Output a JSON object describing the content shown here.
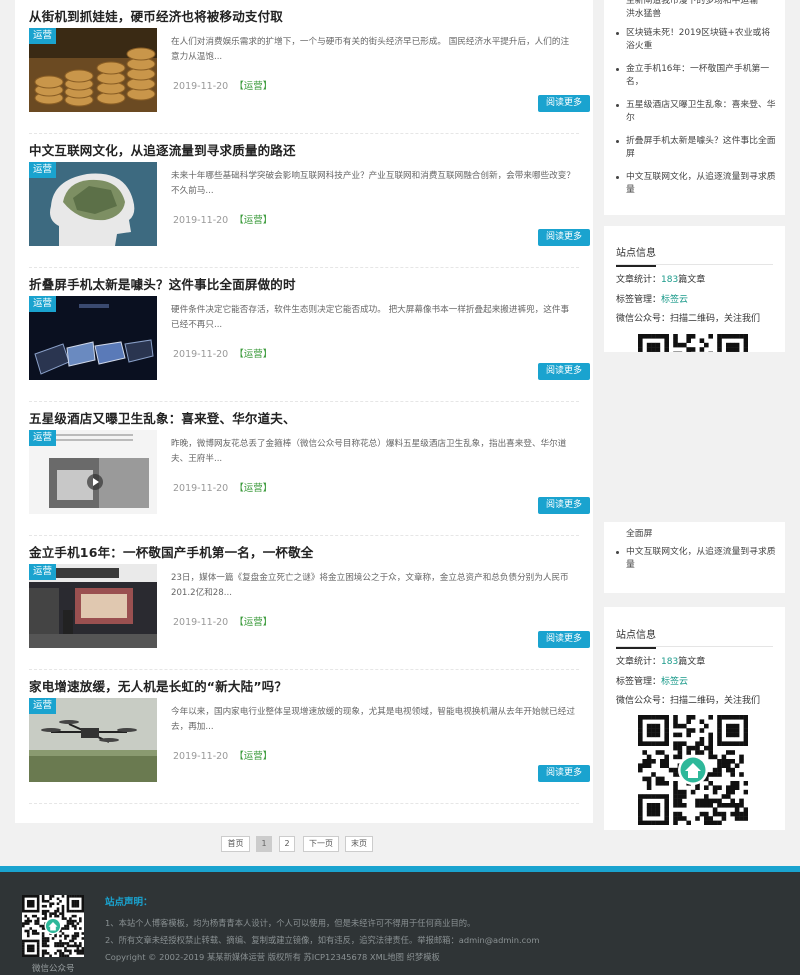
{
  "posts": [
    {
      "title": "从街机到抓娃娃，硬币经济也将被移动支付取",
      "excerpt": "在人们对消费娱乐需求的扩增下，一个与硬币有关的街头经济早已形成。 国民经济水平提升后，人们的注意力从温饱...",
      "date": "2019-11-20",
      "category": "【运营】",
      "badge": "运营",
      "read_more": "阅读更多",
      "thumb_icon": "coins-image"
    },
    {
      "title": "中文互联网文化，从追逐流量到寻求质量的路还",
      "excerpt": "未来十年哪些基础科学突破会影响互联网科技产业？产业互联网和消费互联网融合创新，会带来哪些改变？不久前马...",
      "date": "2019-11-20",
      "category": "【运营】",
      "badge": "运营",
      "read_more": "阅读更多",
      "thumb_icon": "money-head-image"
    },
    {
      "title": "折叠屏手机太新是噱头？这件事比全面屏做的时",
      "excerpt": "硬件条件决定它能否存活，软件生态则决定它能否成功。 把大屏幕像书本一样折叠起来搬进裤兜，这件事已经不再只...",
      "date": "2019-11-20",
      "category": "【运营】",
      "badge": "运营",
      "read_more": "阅读更多",
      "thumb_icon": "foldable-phones-image"
    },
    {
      "title": "五星级酒店又曝卫生乱象：喜来登、华尔道夫、",
      "excerpt": "昨晚，微博网友花总丢了金箍棒（微信公众号目称花总）爆料五星级酒店卫生乱象，指出喜来登、华尔道夫、王府半...",
      "date": "2019-11-20",
      "category": "【运营】",
      "badge": "运营",
      "read_more": "阅读更多",
      "thumb_icon": "hotel-video-image"
    },
    {
      "title": "金立手机16年：一杯敬国产手机第一名，一杯敬全",
      "excerpt": "23日，媒体一篇《复盘金立死亡之谜》将金立困境公之于众，文章称，金立总资产和总负债分别为人民币201.2亿和28...",
      "date": "2019-11-20",
      "category": "【运营】",
      "badge": "运营",
      "read_more": "阅读更多",
      "thumb_icon": "gionee-store-image"
    },
    {
      "title": "家电增速放缓，无人机是长虹的“新大陆”吗？",
      "excerpt": "今年以来，国内家电行业整体呈现增速放缓的现象，尤其是电视领域，智能电视换机潮从去年开始就已经过去，再加...",
      "date": "2019-11-20",
      "category": "【运营】",
      "badge": "运营",
      "read_more": "阅读更多",
      "thumb_icon": "drone-image"
    }
  ],
  "pagination": {
    "first": "首页",
    "page1": "1",
    "page2": "2",
    "next": "下一页",
    "last": "末页"
  },
  "sidebar_upper": {
    "partial_top_line1": "至新闸造我市漫下的多场和中运输",
    "partial_top_line2": "洪水猛兽",
    "items": [
      "区块链未死！2019区块链+农业或将浴火重",
      "金立手机16年：一杯敬国产手机第一名，",
      "五星级酒店又曝卫生乱象：喜来登、华尔",
      "折叠屏手机太新是噱头？这件事比全面屏",
      "中文互联网文化，从追逐流量到寻求质量"
    ]
  },
  "site_info_upper": {
    "title": "站点信息",
    "articles_label": "文章统计：",
    "articles_value": "183",
    "articles_unit": "篇文章",
    "tags_label": "标签管理：",
    "tags_value": "标签云",
    "wechat_label": "微信公众号：扫描二维码，关注我们"
  },
  "sidebar_lower": {
    "partial_line": "全面屏",
    "items": [
      "中文互联网文化，从追逐流量到寻求质量"
    ]
  },
  "site_info_lower": {
    "title": "站点信息",
    "articles_label": "文章统计：",
    "articles_value": "183",
    "articles_unit": "篇文章",
    "tags_label": "标签管理：",
    "tags_value": "标签云",
    "wechat_label": "微信公众号：扫描二维码，关注我们"
  },
  "footer": {
    "qr_label": "微信公众号",
    "title": "站点声明：",
    "line1": "1、本站个人博客模板，均为杨青青本人设计，个人可以使用，但是未经许可不得用于任何商业目的。",
    "line2": "2、所有文章未经授权禁止转载、摘编、复制或建立镜像，如有违反，追究法律责任。举报邮箱：admin@admin.com",
    "copyright": "Copyright © 2002-2019 某某新媒体运营 版权所有 苏ICP12345678 XML地图 织梦模板"
  },
  "colors": {
    "accent": "#1aa3cf",
    "category": "#3a9a3a",
    "stat": "#1a9a8a",
    "footer_bg": "#2f3436"
  }
}
